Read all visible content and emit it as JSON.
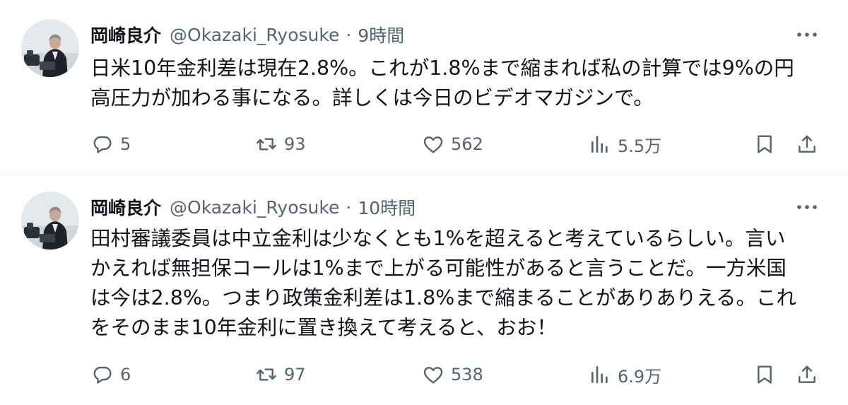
{
  "tweets": [
    {
      "author": "岡崎良介",
      "handle": "@Okazaki_Ryosuke",
      "separator": "·",
      "time": "9時間",
      "lines": [
        "日米10年金利差は現在2.8%。これが1.8%まで縮まれば私の計算では9%の円",
        "高圧力が加わる事になる。詳しくは今日のビデオマガジンで。"
      ],
      "replies": "5",
      "retweets": "93",
      "likes": "562",
      "views": "5.5万"
    },
    {
      "author": "岡崎良介",
      "handle": "@Okazaki_Ryosuke",
      "separator": "·",
      "time": "10時間",
      "lines": [
        "田村審議委員は中立金利は少なくとも1%を超えると考えているらしい。言い",
        "かえれば無担保コールは1%まで上がる可能性があると言うことだ。一方米国",
        "は今は2.8%。つまり政策金利差は1.8%まで縮まることがありありえる。これ",
        "をそのまま10年金利に置き換えて考えると、おお！"
      ],
      "replies": "6",
      "retweets": "97",
      "likes": "538",
      "views": "6.9万"
    }
  ],
  "icons": {
    "more": "more-horizontal-icon",
    "reply": "reply-bubble-icon",
    "retweet": "retweet-arrows-icon",
    "like": "heart-icon",
    "views": "bar-chart-icon",
    "bookmark": "bookmark-icon",
    "share": "share-upload-icon"
  },
  "colors": {
    "text": "#0f1419",
    "secondary": "#536471",
    "divider": "#e8ebed"
  }
}
